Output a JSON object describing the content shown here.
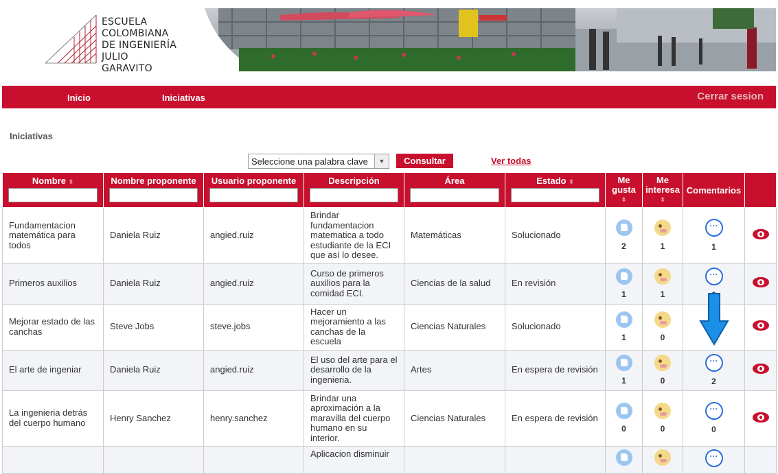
{
  "header": {
    "logo_lines": [
      "ESCUELA",
      "COLOMBIANA",
      "DE INGENIERÍA",
      "JULIO GARAVITO"
    ]
  },
  "nav": {
    "items": [
      "Inicio",
      "Iniciativas"
    ],
    "logout": "Cerrar sesion"
  },
  "page": {
    "title": "Iniciativas"
  },
  "filter": {
    "keyword_selected": "Seleccione una palabra clave",
    "consult_button": "Consultar",
    "show_all_link": "Ver todas"
  },
  "table": {
    "columns": [
      "Nombre",
      "Nombre proponente",
      "Usuario proponente",
      "Descripción",
      "Área",
      "Estado",
      "Me gusta",
      "Me interesa",
      "Comentarios"
    ],
    "rows": [
      {
        "nombre": "Fundamentacion matemática para todos",
        "proponente": "Daniela Ruiz",
        "usuario": "angied.ruiz",
        "descripcion": "Brindar fundamentacion matematica a todo estudiante de la ECI que así lo desee.",
        "area": "Matemáticas",
        "estado": "Solucionado",
        "me_gusta": "2",
        "me_interesa": "1",
        "comentarios": "1"
      },
      {
        "nombre": "Primeros auxilios",
        "proponente": "Daniela Ruiz",
        "usuario": "angied.ruiz",
        "descripcion": "Curso de primeros auxilios para la comidad ECI.",
        "area": "Ciencias de la salud",
        "estado": "En revisión",
        "me_gusta": "1",
        "me_interesa": "1",
        "comentarios": "0"
      },
      {
        "nombre": "Mejorar estado de las canchas",
        "proponente": "Steve Jobs",
        "usuario": "steve.jobs",
        "descripcion": "Hacer un mejoramiento a las canchas de la escuela",
        "area": "Ciencias Naturales",
        "estado": "Solucionado",
        "me_gusta": "1",
        "me_interesa": "0",
        "comentarios": ""
      },
      {
        "nombre": "El arte de ingeniar",
        "proponente": "Daniela Ruiz",
        "usuario": "angied.ruiz",
        "descripcion": "El uso del arte para el desarrollo de la ingenieria.",
        "area": "Artes",
        "estado": "En espera de revisión",
        "me_gusta": "1",
        "me_interesa": "0",
        "comentarios": "2"
      },
      {
        "nombre": "La ingenieria detrás del cuerpo humano",
        "proponente": "Henry Sanchez",
        "usuario": "henry.sanchez",
        "descripcion": "Brindar una aproximación a la maravilla del cuerpo humano en su interior.",
        "area": "Ciencias Naturales",
        "estado": "En espera de revisión",
        "me_gusta": "0",
        "me_interesa": "0",
        "comentarios": "0"
      },
      {
        "nombre": "",
        "proponente": "",
        "usuario": "",
        "descripcion": "Aplicacion disminuir",
        "area": "",
        "estado": "",
        "me_gusta": "",
        "me_interesa": "",
        "comentarios": ""
      }
    ]
  },
  "colors": {
    "brand_red": "#c8102e",
    "link_blue": "#2a6fdc"
  }
}
